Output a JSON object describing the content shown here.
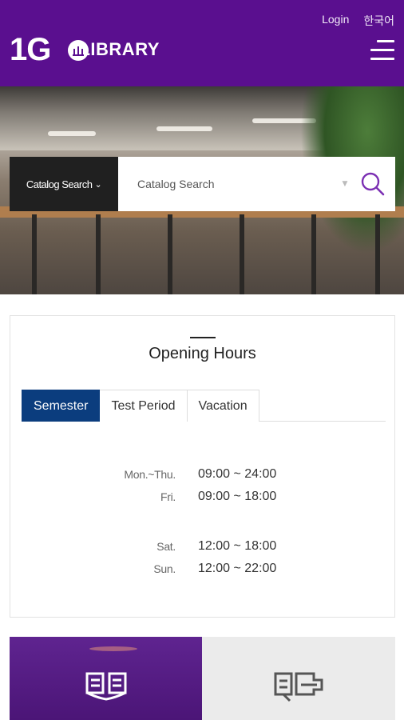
{
  "header": {
    "logo_number": "1G",
    "logo_text": "LIBRARY",
    "login_label": "Login",
    "language_label": "한국어",
    "menu_icon": "hamburger-menu-icon",
    "background_color": "#5a0f8f"
  },
  "search": {
    "scope_label": "Catalog Search",
    "placeholder": "Catalog Search",
    "search_icon": "magnifier-icon",
    "accent_color": "#7b2fb3"
  },
  "opening_hours": {
    "title": "Opening Hours",
    "tabs": [
      {
        "label": "Semester",
        "active": true
      },
      {
        "label": "Test Period",
        "active": false
      },
      {
        "label": "Vacation",
        "active": false
      }
    ],
    "rows": [
      {
        "day": "Mon.~Thu.",
        "time": "09:00 ~ 24:00"
      },
      {
        "day": "Fri.",
        "time": "09:00 ~ 18:00"
      },
      {
        "day": "Sat.",
        "time": "12:00 ~ 18:00"
      },
      {
        "day": "Sun.",
        "time": "12:00 ~ 22:00"
      }
    ],
    "active_tab_color": "#0b3d7e"
  },
  "tiles": [
    {
      "icon": "open-book-icon",
      "active": true
    },
    {
      "icon": "book-return-icon",
      "active": false
    }
  ]
}
